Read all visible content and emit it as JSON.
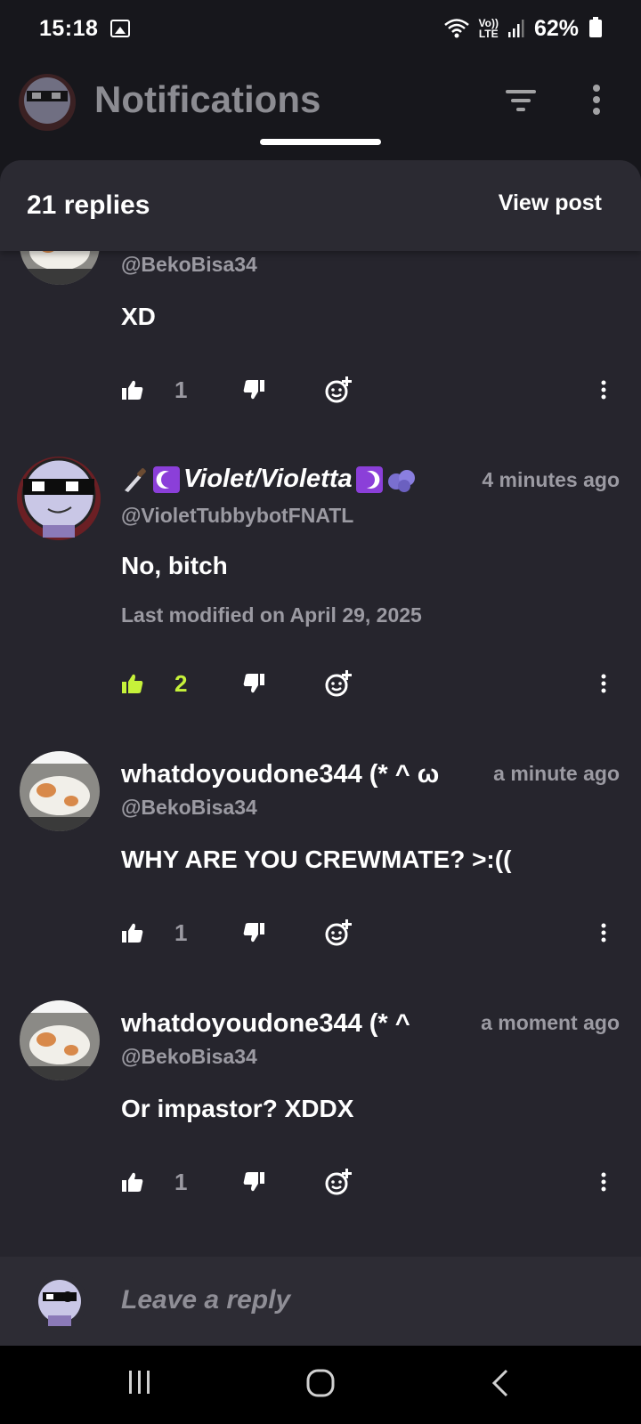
{
  "status_bar": {
    "time": "15:18",
    "network_label_top": "Vo))",
    "network_label_bottom": "LTE",
    "battery": "62%"
  },
  "header": {
    "title": "Notifications"
  },
  "sheet": {
    "reply_count": "21 replies",
    "view_post_label": "View post"
  },
  "comments": [
    {
      "name": "",
      "handle": "@BekoBisa34",
      "time": "",
      "text": "XD",
      "likes": "1",
      "liked": false
    },
    {
      "name": "Violet/Violetta",
      "handle": "@VioletTubbybotFNATL",
      "time": "4 minutes ago",
      "text": "No, bitch",
      "modified": "Last modified on April 29, 2025",
      "likes": "2",
      "liked": true
    },
    {
      "name": "whatdoyoudone344 (* ^ ω",
      "handle": "@BekoBisa34",
      "time": "a minute ago",
      "text": "WHY ARE YOU CREWMATE? >:((",
      "likes": "1",
      "liked": false
    },
    {
      "name": "whatdoyoudone344 (* ^",
      "handle": "@BekoBisa34",
      "time": "a moment ago",
      "text": "Or impastor? XDDX",
      "likes": "1",
      "liked": false
    }
  ],
  "reply_bar": {
    "placeholder": "Leave a reply"
  },
  "colors": {
    "background": "#17171c",
    "sheet": "#26252d",
    "accent_like": "#c6f23a",
    "muted_text": "#9b9aa2"
  },
  "icons": {
    "like": "thumbs-up-icon",
    "dislike": "thumbs-down-icon",
    "react": "add-reaction-icon",
    "more": "more-vertical-icon",
    "filter": "filter-icon"
  }
}
